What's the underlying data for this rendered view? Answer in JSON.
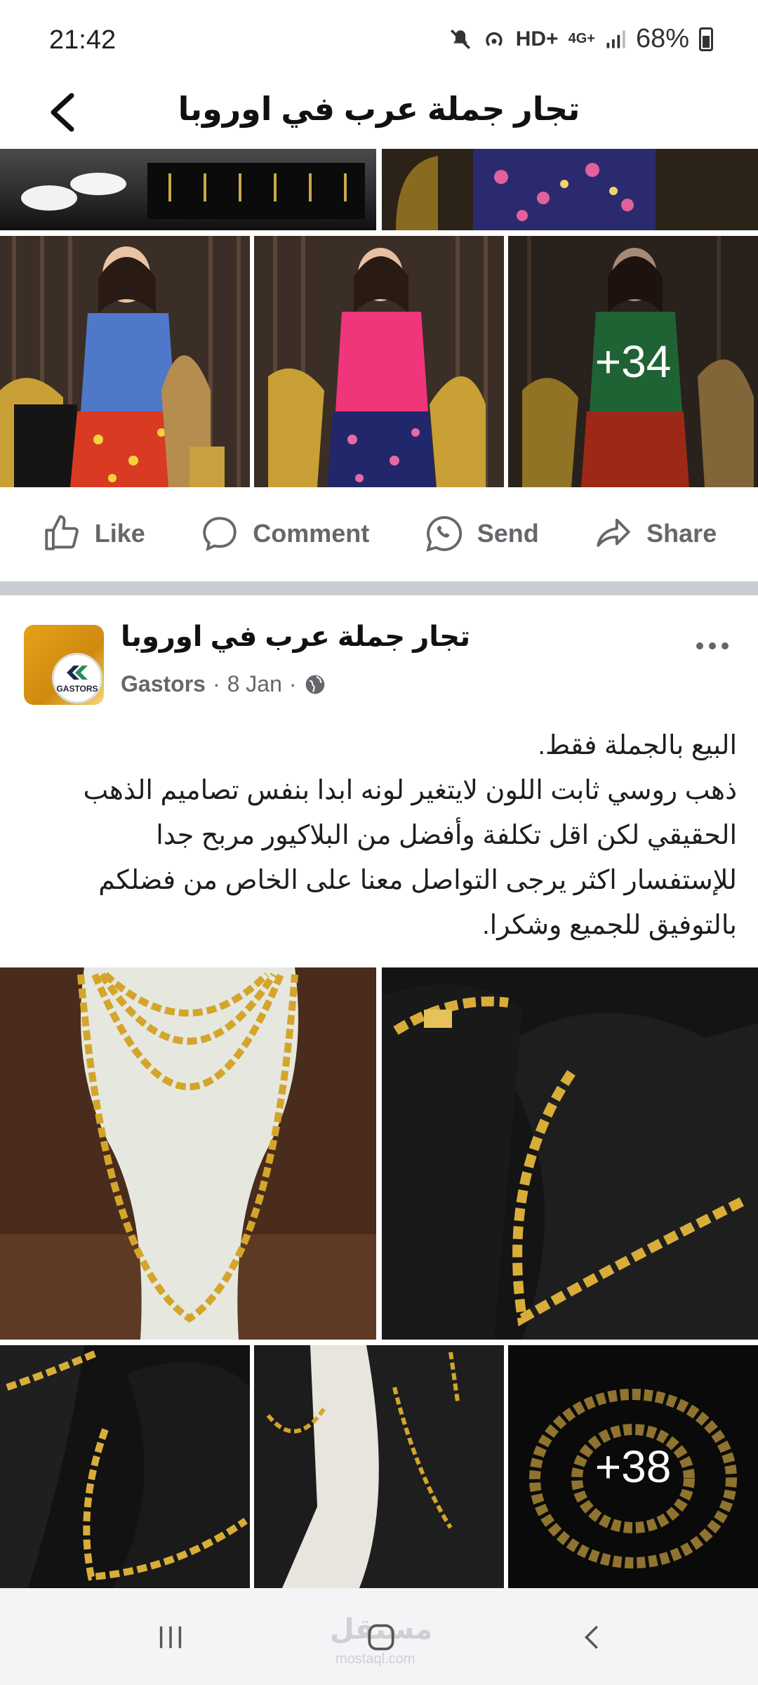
{
  "status": {
    "time": "21:42",
    "network": "HD+",
    "cell": "4G+",
    "battery": "68%"
  },
  "header": {
    "title": "تجار جملة عرب في اوروبا"
  },
  "first_post": {
    "more_count": "+34"
  },
  "actions": {
    "like": "Like",
    "comment": "Comment",
    "send": "Send",
    "share": "Share"
  },
  "post": {
    "group_name": "تجار جملة عرب في اوروبا",
    "author": "Gastors",
    "date": "8 Jan",
    "avatar_label": "GASTORS",
    "text_lines": [
      "البيع بالجملة فقط.",
      "ذهب روسي ثابت اللون لايتغير لونه ابدا بنفس تصاميم الذهب",
      "الحقيقي لكن اقل تكلفة وأفضل من البلاكيور مربح جدا",
      "للإستفسار اكثر يرجى التواصل معنا على الخاص من فضلكم",
      "بالتوفيق للجميع وشكرا."
    ],
    "more_count": "+38"
  },
  "navbar": {
    "watermark": "مستقل",
    "watermark_sub": "mostaql.com"
  },
  "icons": {
    "back": "chevron-left-icon",
    "like": "thumbs-up-icon",
    "comment": "speech-bubble-icon",
    "send": "whatsapp-icon",
    "share": "share-arrow-icon",
    "privacy": "globe-icon"
  },
  "colors": {
    "action_gray": "#65676b",
    "divider": "#c9ccd1",
    "gold": "#d4a52b"
  }
}
